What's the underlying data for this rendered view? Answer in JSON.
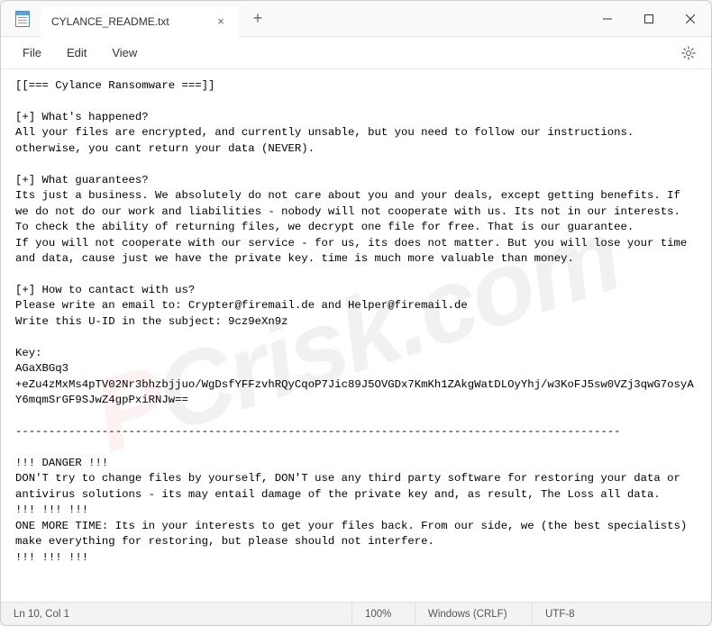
{
  "titlebar": {
    "tab_title": "CYLANCE_README.txt",
    "close_tab": "×",
    "new_tab": "+"
  },
  "window_controls": {
    "minimize": "—",
    "maximize": "☐",
    "close": "✕"
  },
  "menubar": {
    "file": "File",
    "edit": "Edit",
    "view": "View"
  },
  "content": {
    "text": "[[=== Cylance Ransomware ===]]\n\n[+] What's happened?\nAll your files are encrypted, and currently unsable, but you need to follow our instructions. otherwise, you cant return your data (NEVER).\n\n[+] What guarantees?\nIts just a business. We absolutely do not care about you and your deals, except getting benefits. If we do not do our work and liabilities - nobody will not cooperate with us. Its not in our interests.\nTo check the ability of returning files, we decrypt one file for free. That is our guarantee.\nIf you will not cooperate with our service - for us, its does not matter. But you will lose your time and data, cause just we have the private key. time is much more valuable than money.\n\n[+] How to cantact with us?\nPlease write an email to: Crypter@firemail.de and Helper@firemail.de\nWrite this U-ID in the subject: 9cz9eXn9z\n\nKey:\nAGaXBGq3\n+eZu4zMxMs4pTV02Nr3bhzbjjuo/WgDsfYFFzvhRQyCqoP7Jic89J5OVGDx7KmKh1ZAkgWatDLOyYhj/w3KoFJ5sw0VZj3qwG7osyAY6mqmSrGF9SJwZ4gpPxiRNJw==\n\n-------------------------------------------------------------------------------------------\n\n!!! DANGER !!!\nDON'T try to change files by yourself, DON'T use any third party software for restoring your data or antivirus solutions - its may entail damage of the private key and, as result, The Loss all data.\n!!! !!! !!!\nONE MORE TIME: Its in your interests to get your files back. From our side, we (the best specialists) make everything for restoring, but please should not interfere.\n!!! !!! !!!"
  },
  "statusbar": {
    "cursor": "Ln 10, Col 1",
    "zoom": "100%",
    "line_ending": "Windows (CRLF)",
    "encoding": "UTF-8"
  },
  "watermark": {
    "p": "P",
    "c": "C",
    "rest": "risk.com"
  }
}
